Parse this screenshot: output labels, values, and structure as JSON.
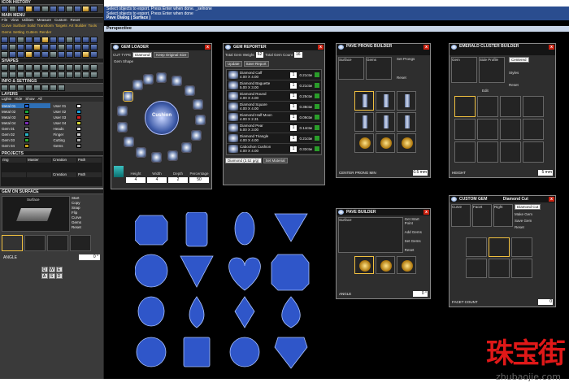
{
  "left": {
    "icon_history": "ICON HISTORY",
    "main_menu": "MAIN MENU",
    "menu_items": [
      "File",
      "View",
      "Utilities",
      "Measure",
      "Custom",
      "Reset"
    ],
    "links": [
      "Curve",
      "Surface",
      "Solid",
      "Transform",
      "Targets",
      "Art",
      "Builder",
      "Tools",
      "Gems",
      "Setting",
      "Cutters",
      "Render"
    ],
    "shapes": "SHAPES",
    "info_settings": "INFO & SETTINGS",
    "layers_title": "LAYERS",
    "layers_head": [
      "Lights",
      "Hide",
      "Show",
      "All"
    ],
    "layers": [
      {
        "name": "Metal 01",
        "color": "#1f5fd0"
      },
      {
        "name": "Metal 02",
        "color": "#19a63c"
      },
      {
        "name": "Metal 03",
        "color": "#d89a1b"
      },
      {
        "name": "Metal 04",
        "color": "#7a2db5"
      },
      {
        "name": "Gem 01",
        "color": "#8c8c8c"
      },
      {
        "name": "Gem 02",
        "color": "#28b7c9"
      },
      {
        "name": "Gem 03",
        "color": "#2ea82e"
      },
      {
        "name": "Gem 04",
        "color": "#caa21c"
      },
      {
        "name": "User 01",
        "color": "#e8e8e8"
      },
      {
        "name": "User 02",
        "color": "#22a3e0"
      },
      {
        "name": "User 03",
        "color": "#d82020"
      },
      {
        "name": "User 04",
        "color": "#d6d63a"
      },
      {
        "name": "Heads",
        "color": "#e0e0e0"
      },
      {
        "name": "Finger",
        "color": "#cfcfcf"
      },
      {
        "name": "Cutting",
        "color": "#b0b0b0"
      },
      {
        "name": "Gems",
        "color": "#9a9a9a"
      }
    ],
    "projects": "PROJECTS",
    "proj_cells": [
      "ring",
      "Master",
      "Creation",
      "Path",
      "",
      "",
      "Creation",
      "Path"
    ],
    "gem_on_surface": "GEM ON SURFACE",
    "surface_label": "Surface",
    "gs_list": [
      "Start",
      "Copy",
      "Snap",
      "Flip",
      "Curve",
      "Gems",
      "Reset"
    ],
    "angle_label": "ANGLE",
    "angle_value": "0 °",
    "keys": [
      "Q",
      "W",
      "E",
      "A",
      "S",
      "D"
    ]
  },
  "status": {
    "line1": "Select objects to export. Press Enter when done. _selnone",
    "line2": "Select objects to export. Press Enter when done",
    "line3": "Pave Dialog ( Surface )"
  },
  "viewport_title": "Perspective",
  "gem_loader": {
    "title": "GEM LOADER",
    "cut_type_label": "CUT TYPE",
    "cut_type_value": "Diamond",
    "keep_size": "Keep Original Size",
    "gem_shape": "Gem Shape",
    "center_name": "Cushion",
    "dims_labels": [
      "Height",
      "Width",
      "Depth",
      "Percentage"
    ],
    "dims_values": [
      "4",
      "4",
      "2",
      "50"
    ]
  },
  "gem_reporter": {
    "title": "GEM REPORTER",
    "total_weight_label": "Total Gem Weight",
    "total_weight_value": "62",
    "total_count_label": "Total Gem Count",
    "total_count_value": "16",
    "update": "Update",
    "save_report": "Save Report",
    "items": [
      {
        "name": "Diamond Calf",
        "size": "4.00 X 4.00",
        "qty": "1",
        "ct": "0.21ctw"
      },
      {
        "name": "Diamond Baguette",
        "size": "5.00 X 3.00",
        "qty": "1",
        "ct": "0.21ctw"
      },
      {
        "name": "Diamond Round",
        "size": "4.00 X 4.00",
        "qty": "1",
        "ct": "0.25ctw"
      },
      {
        "name": "Diamond Square",
        "size": "4.00 X 4.00",
        "qty": "1",
        "ct": "0.38ctw"
      },
      {
        "name": "Diamond Half Moon",
        "size": "4.00 X 2.31",
        "qty": "1",
        "ct": "0.09ctw"
      },
      {
        "name": "Diamond Pear",
        "size": "5.00 X 3.00",
        "qty": "1",
        "ct": "0.14ctw"
      },
      {
        "name": "Diamond Triangle",
        "size": "4.00 X 4.00",
        "qty": "1",
        "ct": "0.21ctw"
      },
      {
        "name": "Cabochon Cushion",
        "size": "4.00 X 4.00",
        "qty": "1",
        "ct": "0.32ctw"
      }
    ],
    "footer_select": "Diamond (3.52 g/g)",
    "set_material": "Set Material"
  },
  "pave_prong": {
    "title": "PAVE PRONG BUILDER",
    "tabs": [
      "Surface",
      "Gems"
    ],
    "set_prongs": "Set Prongs",
    "reset": "Reset",
    "footer_label": "CENTER PRONG MIN",
    "footer_value": "0.5 mm"
  },
  "emerald": {
    "title": "EMERALD CLUSTER BUILDER",
    "tabs": [
      "Gem",
      "Side Profile"
    ],
    "mode": "Centered",
    "edit": "Edit",
    "styles": "Styles",
    "reset": "Reset",
    "footer_label": "HEIGHT",
    "footer_value": "5 mm"
  },
  "pave_builder": {
    "title": "PAVE BUILDER",
    "tab": "Surface",
    "menu": [
      "Get Start Point",
      "Add Gems",
      "Set Gems",
      "Reset"
    ],
    "footer_label": "ANGLE",
    "footer_value": "0 °"
  },
  "custom_gem": {
    "title": "CUSTOM GEM",
    "subtitle": "Diamond Cut",
    "tabs": [
      "Curve",
      "Facet",
      "Right"
    ],
    "mode": "Diamond Cut",
    "menu": [
      "Make Gem",
      "Save Gem",
      "Reset"
    ],
    "footer_label": "FACET COUNT",
    "footer_value": "0"
  },
  "watermark": {
    "cn": "珠宝街",
    "url": "zhubaojie.com"
  },
  "colors": {
    "accent": "#f0c040",
    "gem": "#4a74e0",
    "status": "#2a4d8f"
  }
}
